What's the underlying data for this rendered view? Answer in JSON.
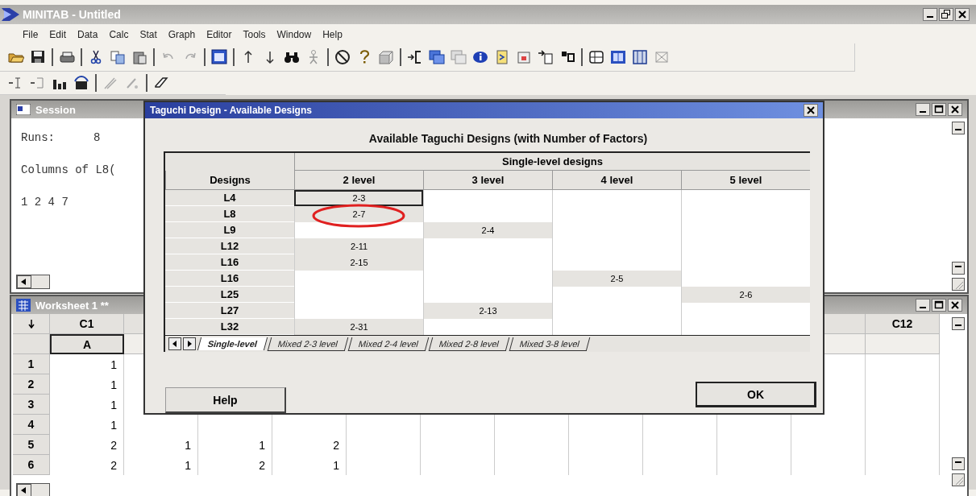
{
  "app": {
    "title": "MINITAB - Untitled"
  },
  "menu": [
    "File",
    "Edit",
    "Data",
    "Calc",
    "Stat",
    "Graph",
    "Editor",
    "Tools",
    "Window",
    "Help"
  ],
  "session": {
    "title": "Session",
    "lines": [
      {
        "label": "Runs:",
        "value": "8"
      },
      {
        "label": "Columns of L8("
      },
      {
        "label": "1 2 4 7"
      }
    ]
  },
  "worksheet": {
    "title": "Worksheet 1 **",
    "columns": [
      {
        "header": "C1",
        "name": "A"
      },
      {},
      {},
      {},
      {},
      {},
      {},
      {},
      {},
      {},
      {},
      {
        "header": "C12"
      }
    ],
    "rows": [
      {
        "label": "1",
        "cells": [
          "1"
        ]
      },
      {
        "label": "2",
        "cells": [
          "1"
        ]
      },
      {
        "label": "3",
        "cells": [
          "1"
        ]
      },
      {
        "label": "4",
        "cells": [
          "1"
        ]
      },
      {
        "label": "5",
        "cells": [
          "2",
          "1",
          "1",
          "2"
        ]
      },
      {
        "label": "6",
        "cells": [
          "2",
          "1",
          "2",
          "1"
        ]
      }
    ]
  },
  "dialog": {
    "title": "Taguchi Design - Available Designs",
    "heading": "Available Taguchi Designs (with Number of Factors)",
    "table": {
      "group_header": "Single-level designs",
      "columns": [
        "Designs",
        "2 level",
        "3 level",
        "4 level",
        "5 level"
      ],
      "rows": [
        {
          "cells": [
            "L4",
            "2-3",
            "",
            "",
            ""
          ],
          "selected": true,
          "circled": false
        },
        {
          "cells": [
            "L8",
            "2-7",
            "",
            "",
            ""
          ],
          "selected": false,
          "circled": true
        },
        {
          "cells": [
            "L9",
            "",
            "2-4",
            "",
            ""
          ],
          "selected": false,
          "circled": false
        },
        {
          "cells": [
            "L12",
            "2-11",
            "",
            "",
            ""
          ],
          "selected": false,
          "circled": false
        },
        {
          "cells": [
            "L16",
            "2-15",
            "",
            "",
            ""
          ],
          "selected": false,
          "circled": false
        },
        {
          "cells": [
            "L16",
            "",
            "",
            "2-5",
            ""
          ],
          "selected": false,
          "circled": false
        },
        {
          "cells": [
            "L25",
            "",
            "",
            "",
            "2-6"
          ],
          "selected": false,
          "circled": false
        },
        {
          "cells": [
            "L27",
            "",
            "2-13",
            "",
            ""
          ],
          "selected": false,
          "circled": false
        },
        {
          "cells": [
            "L32",
            "2-31",
            "",
            "",
            ""
          ],
          "selected": false,
          "circled": false
        }
      ]
    },
    "tabs": [
      {
        "label": "Single-level",
        "selected": true
      },
      {
        "label": "Mixed 2-3 level",
        "selected": false
      },
      {
        "label": "Mixed 2-4 level",
        "selected": false
      },
      {
        "label": "Mixed 2-8 level",
        "selected": false
      },
      {
        "label": "Mixed 3-8 level",
        "selected": false
      }
    ],
    "buttons": [
      {
        "label": "Help",
        "kind": "help"
      },
      {
        "label": "OK",
        "kind": "ok"
      }
    ]
  }
}
